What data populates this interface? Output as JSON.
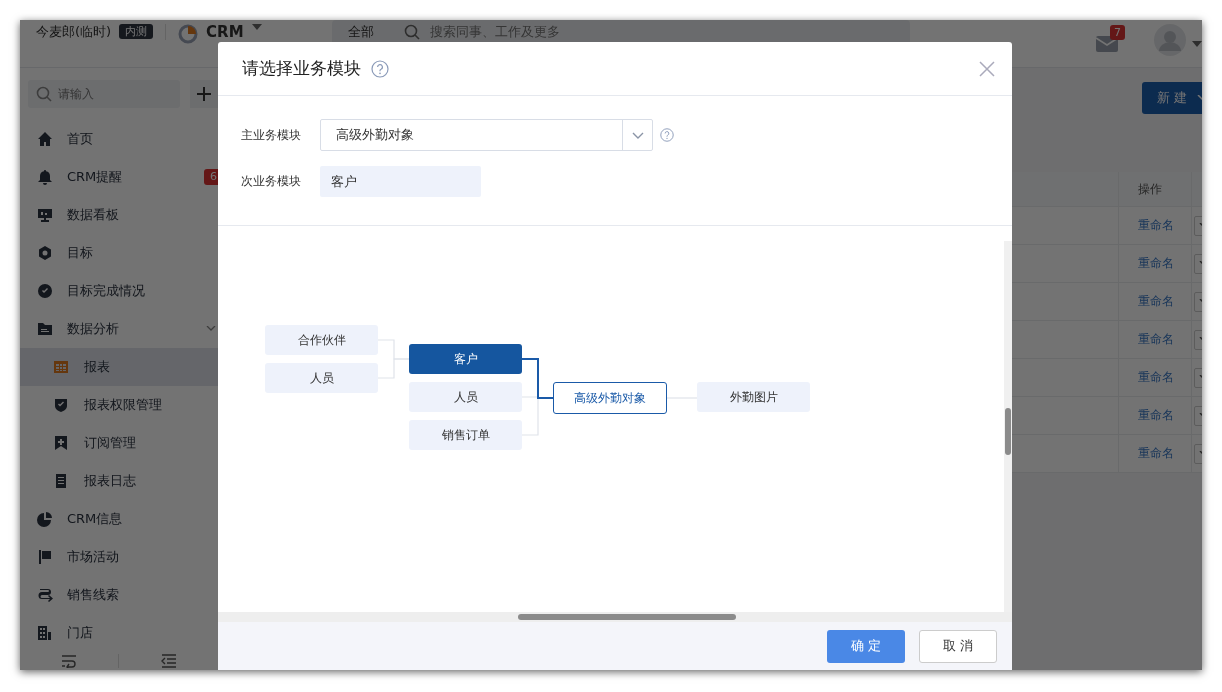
{
  "background_app": {
    "topbar": {
      "user_name": "今麦郎(临时)",
      "tag": "内测",
      "app_name": "CRM",
      "scope": "全部",
      "search": {
        "placeholder": "搜索同事、工作及更多"
      },
      "mail_badge": "7"
    },
    "sidebar": {
      "search": {
        "placeholder": "请输入"
      },
      "items": [
        {
          "label": "首页",
          "selected": false
        },
        {
          "label": "CRM提醒",
          "selected": false,
          "badge": "6"
        },
        {
          "label": "数据看板",
          "selected": false
        },
        {
          "label": "目标",
          "selected": false
        },
        {
          "label": "目标完成情况",
          "selected": false
        },
        {
          "label": "数据分析",
          "selected": false,
          "expanded": true,
          "children": [
            {
              "label": "报表",
              "selected": true
            },
            {
              "label": "报表权限管理",
              "selected": false
            },
            {
              "label": "订阅管理",
              "selected": false
            },
            {
              "label": "报表日志",
              "selected": false
            }
          ]
        },
        {
          "label": "CRM信息",
          "selected": false
        },
        {
          "label": "市场活动",
          "selected": false
        },
        {
          "label": "销售线索",
          "selected": false
        },
        {
          "label": "门店",
          "selected": false
        }
      ]
    },
    "main": {
      "new_button": "新建",
      "table": {
        "columns": [
          "操作"
        ],
        "rows": [
          {
            "action": "重命名"
          },
          {
            "action": "重命名"
          },
          {
            "action": "重命名"
          },
          {
            "action": "重命名"
          },
          {
            "action": "重命名"
          },
          {
            "action": "重命名"
          },
          {
            "action": "重命名"
          }
        ]
      }
    }
  },
  "dialog": {
    "title": "请选择业务模块",
    "primary_module": {
      "label": "主业务模块",
      "value": "高级外勤对象"
    },
    "secondary_module": {
      "label": "次业务模块",
      "value": "客户"
    },
    "diagram": {
      "center": {
        "label": "高级外勤对象",
        "selected": false
      },
      "upstream": [
        {
          "label": "客户",
          "selected": true,
          "upstream": [
            {
              "label": "合作伙伴",
              "selected": false
            },
            {
              "label": "人员",
              "selected": false
            }
          ]
        },
        {
          "label": "人员",
          "selected": false
        },
        {
          "label": "销售订单",
          "selected": false
        }
      ],
      "downstream": [
        {
          "label": "外勤图片",
          "selected": false
        }
      ]
    },
    "buttons": [
      {
        "label": "确 定",
        "kind": "primary"
      },
      {
        "label": "取 消",
        "kind": "secondary"
      }
    ]
  }
}
